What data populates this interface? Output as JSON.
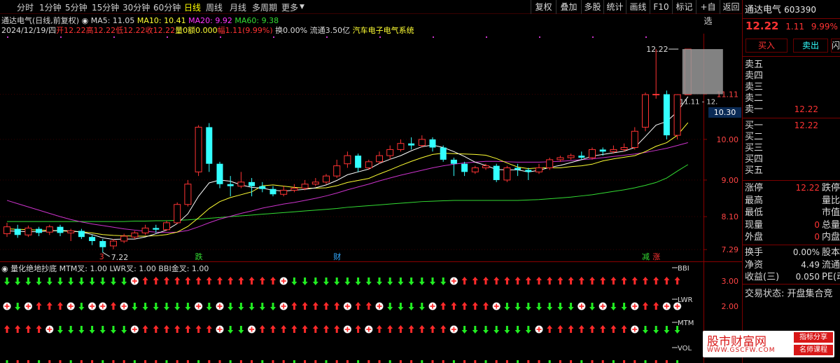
{
  "toolbar": {
    "left_items": [
      "分时",
      "1分钟",
      "5分钟",
      "15分钟",
      "30分钟",
      "60分钟",
      "日线",
      "周线",
      "月线",
      "多周期",
      "更多"
    ],
    "active_index": 6,
    "right_items": [
      "复权",
      "叠加",
      "多股",
      "统计",
      "画线",
      "F10",
      "标记",
      "+自选",
      "返回"
    ]
  },
  "info": {
    "name_mode": "通达电气(日线,前复权)",
    "ma5": "MA5: 11.05",
    "ma10": "MA10: 10.41",
    "ma20": "MA20: 9.92",
    "ma60": "MA60: 9.38",
    "date": "2024/12/19/四",
    "open": "开12.22",
    "high": "高12.22",
    "low": "低12.22",
    "close": "收12.22",
    "vol": "量0",
    "amount": "额0.000",
    "change": "幅1.11(9.99%)",
    "turnover": "换0.00%",
    "float": "流通3.50亿",
    "sector": "汽车电子电气系统",
    "colors": {
      "ma5": "#ffffff",
      "ma10": "#ffff33",
      "ma20": "#ff33ff",
      "ma60": "#33dd33",
      "up": "#ff3333",
      "down": "#33ffff"
    }
  },
  "main_chart": {
    "y_labels": [
      "11.11",
      "10.00",
      "9.00",
      "8.10",
      "7.29"
    ],
    "y_values": [
      11.11,
      10.0,
      9.0,
      8.1,
      7.29
    ],
    "high_marker": "12.22",
    "low_marker": "7.22",
    "range_label": "11.11 - 12.",
    "current_price_tag": "10.30",
    "event_marks": [
      {
        "index": 9,
        "text": "3",
        "color": "#ff3333"
      },
      {
        "index": 18,
        "text": "跌",
        "color": "#33dd33"
      },
      {
        "index": 31,
        "text": "财",
        "color": "#33aaff"
      },
      {
        "index": 60,
        "text": "减",
        "color": "#33dd33"
      },
      {
        "index": 61,
        "text": "涨",
        "color": "#ff3333"
      }
    ]
  },
  "chart_data": {
    "type": "candlestick",
    "ylim": [
      7.0,
      12.6
    ],
    "candles": [
      [
        7.68,
        7.85,
        7.6,
        7.95
      ],
      [
        7.8,
        7.65,
        7.58,
        7.9
      ],
      [
        7.65,
        7.82,
        7.6,
        7.88
      ],
      [
        7.8,
        7.7,
        7.62,
        7.85
      ],
      [
        7.72,
        7.85,
        7.65,
        7.9
      ],
      [
        7.85,
        7.7,
        7.62,
        7.9
      ],
      [
        7.7,
        7.75,
        7.5,
        7.8
      ],
      [
        7.75,
        7.6,
        7.55,
        7.8
      ],
      [
        7.6,
        7.5,
        7.4,
        7.65
      ],
      [
        7.5,
        7.35,
        7.22,
        7.55
      ],
      [
        7.38,
        7.5,
        7.3,
        7.55
      ],
      [
        7.5,
        7.62,
        7.45,
        7.68
      ],
      [
        7.6,
        7.7,
        7.55,
        7.75
      ],
      [
        7.7,
        7.82,
        7.65,
        7.9
      ],
      [
        7.82,
        7.78,
        7.7,
        7.9
      ],
      [
        7.78,
        7.95,
        7.75,
        8.0
      ],
      [
        7.95,
        8.4,
        7.92,
        8.45
      ],
      [
        8.4,
        8.9,
        8.35,
        9.0
      ],
      [
        9.2,
        10.3,
        9.1,
        10.35
      ],
      [
        10.3,
        9.4,
        9.2,
        10.4
      ],
      [
        9.4,
        8.9,
        8.8,
        9.45
      ],
      [
        8.9,
        8.85,
        8.6,
        9.1
      ],
      [
        8.85,
        8.95,
        8.8,
        9.2
      ],
      [
        8.95,
        8.85,
        8.6,
        9.05
      ],
      [
        8.85,
        8.78,
        8.7,
        8.95
      ],
      [
        8.78,
        8.65,
        8.6,
        8.85
      ],
      [
        8.65,
        8.75,
        8.6,
        8.85
      ],
      [
        8.75,
        8.8,
        8.7,
        8.9
      ],
      [
        8.8,
        8.9,
        8.75,
        9.0
      ],
      [
        8.9,
        8.95,
        8.85,
        9.05
      ],
      [
        8.95,
        9.1,
        8.9,
        9.15
      ],
      [
        9.1,
        9.35,
        9.05,
        9.5
      ],
      [
        9.4,
        9.6,
        9.3,
        9.7
      ],
      [
        9.6,
        9.3,
        9.2,
        9.65
      ],
      [
        9.3,
        9.45,
        9.25,
        9.5
      ],
      [
        9.45,
        9.6,
        9.4,
        9.7
      ],
      [
        9.6,
        9.75,
        9.5,
        9.85
      ],
      [
        9.75,
        9.9,
        9.7,
        10.0
      ],
      [
        9.9,
        9.85,
        9.75,
        10.05
      ],
      [
        9.85,
        10.0,
        9.8,
        10.1
      ],
      [
        10.0,
        9.8,
        9.7,
        10.05
      ],
      [
        9.8,
        9.5,
        9.45,
        9.85
      ],
      [
        9.5,
        9.4,
        9.1,
        9.55
      ],
      [
        9.4,
        9.2,
        9.1,
        9.45
      ],
      [
        9.2,
        9.3,
        9.15,
        9.35
      ],
      [
        9.3,
        9.35,
        9.25,
        9.4
      ],
      [
        9.35,
        9.0,
        8.95,
        9.4
      ],
      [
        9.0,
        9.3,
        8.95,
        9.35
      ],
      [
        9.3,
        9.25,
        9.1,
        9.4
      ],
      [
        9.25,
        9.2,
        9.0,
        9.3
      ],
      [
        9.2,
        9.3,
        9.15,
        9.4
      ],
      [
        9.3,
        9.5,
        9.25,
        9.55
      ],
      [
        9.5,
        9.55,
        9.45,
        9.6
      ],
      [
        9.55,
        9.6,
        9.5,
        9.65
      ],
      [
        9.6,
        9.55,
        9.5,
        9.7
      ],
      [
        9.55,
        9.75,
        9.5,
        9.8
      ],
      [
        9.75,
        9.7,
        9.6,
        9.8
      ],
      [
        9.7,
        9.75,
        9.65,
        9.85
      ],
      [
        9.75,
        9.8,
        9.7,
        9.9
      ],
      [
        9.8,
        10.2,
        9.75,
        10.3
      ],
      [
        10.3,
        11.1,
        10.2,
        11.15
      ],
      [
        11.1,
        11.11,
        11.0,
        12.22
      ],
      [
        11.11,
        10.1,
        10.0,
        11.2
      ],
      [
        10.1,
        11.1,
        10.0,
        11.11
      ],
      [
        11.1,
        12.22,
        11.1,
        12.22
      ]
    ],
    "ma5": [
      7.75,
      7.74,
      7.73,
      7.73,
      7.75,
      7.76,
      7.75,
      7.72,
      7.66,
      7.58,
      7.54,
      7.55,
      7.55,
      7.6,
      7.68,
      7.77,
      7.93,
      8.17,
      8.6,
      8.93,
      9.0,
      8.97,
      8.88,
      8.82,
      8.8,
      8.75,
      8.73,
      8.75,
      8.77,
      8.81,
      8.88,
      8.99,
      9.13,
      9.2,
      9.27,
      9.41,
      9.51,
      9.6,
      9.72,
      9.82,
      9.86,
      9.8,
      9.7,
      9.58,
      9.44,
      9.36,
      9.26,
      9.25,
      9.25,
      9.2,
      9.24,
      9.31,
      9.36,
      9.43,
      9.5,
      9.59,
      9.63,
      9.67,
      9.71,
      9.8,
      10.07,
      10.35,
      10.44,
      10.68,
      11.05
    ],
    "ma10": [
      7.8,
      7.79,
      7.78,
      7.77,
      7.76,
      7.75,
      7.74,
      7.73,
      7.7,
      7.66,
      7.64,
      7.63,
      7.62,
      7.62,
      7.63,
      7.66,
      7.72,
      7.86,
      8.07,
      8.3,
      8.47,
      8.57,
      8.64,
      8.71,
      8.86,
      8.88,
      8.85,
      8.82,
      8.8,
      8.8,
      8.81,
      8.86,
      8.94,
      8.99,
      9.04,
      9.15,
      9.25,
      9.36,
      9.46,
      9.55,
      9.63,
      9.66,
      9.65,
      9.64,
      9.63,
      9.61,
      9.53,
      9.42,
      9.32,
      9.28,
      9.3,
      9.3,
      9.3,
      9.33,
      9.35,
      9.39,
      9.47,
      9.52,
      9.56,
      9.6,
      9.7,
      9.83,
      9.92,
      10.1,
      10.41
    ],
    "ma20": [
      8.5,
      8.42,
      8.34,
      8.26,
      8.18,
      8.1,
      8.03,
      7.97,
      7.92,
      7.88,
      7.84,
      7.8,
      7.77,
      7.74,
      7.72,
      7.71,
      7.72,
      7.76,
      7.85,
      7.95,
      8.04,
      8.11,
      8.18,
      8.24,
      8.31,
      8.36,
      8.41,
      8.45,
      8.5,
      8.55,
      8.61,
      8.68,
      8.76,
      8.83,
      8.9,
      8.98,
      9.05,
      9.12,
      9.18,
      9.24,
      9.3,
      9.35,
      9.39,
      9.42,
      9.44,
      9.46,
      9.46,
      9.45,
      9.44,
      9.44,
      9.44,
      9.45,
      9.46,
      9.48,
      9.5,
      9.52,
      9.55,
      9.58,
      9.61,
      9.64,
      9.68,
      9.73,
      9.78,
      9.85,
      9.92
    ],
    "ma60": [
      7.98,
      7.98,
      7.98,
      7.98,
      7.98,
      7.98,
      7.98,
      7.98,
      7.98,
      7.98,
      7.98,
      7.98,
      7.99,
      7.99,
      8.0,
      8.0,
      8.01,
      8.02,
      8.04,
      8.06,
      8.08,
      8.1,
      8.12,
      8.14,
      8.16,
      8.18,
      8.2,
      8.22,
      8.24,
      8.26,
      8.28,
      8.3,
      8.33,
      8.35,
      8.37,
      8.39,
      8.41,
      8.43,
      8.45,
      8.47,
      8.48,
      8.49,
      8.5,
      8.5,
      8.5,
      8.5,
      8.5,
      8.5,
      8.5,
      8.51,
      8.52,
      8.54,
      8.56,
      8.58,
      8.61,
      8.64,
      8.68,
      8.72,
      8.76,
      8.81,
      8.87,
      8.94,
      9.05,
      9.22,
      9.38
    ]
  },
  "indicator": {
    "title": "量化绝地抄底",
    "mtm": "MTM叉: 1.00",
    "lwr": "LWR叉: 1.00",
    "bbi": "BBI金叉: 1.00",
    "row_labels": [
      "BBI",
      "LWR",
      "MTM",
      "VOL"
    ],
    "y_labels": [
      "3.00",
      "2.00"
    ],
    "rows": [
      "ddddddddddddddddddddddddddddddddddddddddddddddddddddddddddddddddd",
      "ccccccccccccccccccccccccccccccccccccccccccccccccccccccccccccccccc",
      "uuuuuuuuuuuuuuuuuuuuuuuuuuuuuuuuuuuuuuuuuuuuuuuuuuuuuuuuuuuuuuuuu"
    ],
    "row_data": [
      "ddddddddddddcuuuuuuuuuuuuucdddddddddddddddcuuuuuuuuuuuuuuuuuuuuuu",
      "cdcuuucdccucddddddcdcdddddcuuuuucuucddddcuuuuucdddddddcdcddcuucc",
      "uuuucdddddddcuuuuuuucddcuuuuuuuucucuuuuuuucdddddddcuuuuuuuucdddd"
    ],
    "row_values": [
      3.0,
      2.0,
      1.0
    ]
  },
  "right_panel": {
    "stock_name": "通达电气",
    "stock_code": "603390",
    "price": "12.22",
    "change": "1.11",
    "change_pct": "9.99%",
    "buy_btn": "买入",
    "sell_btn": "卖出",
    "more_btn": "闪",
    "asks": [
      {
        "label": "卖五",
        "value": ""
      },
      {
        "label": "卖四",
        "value": ""
      },
      {
        "label": "卖三",
        "value": ""
      },
      {
        "label": "卖二",
        "value": ""
      },
      {
        "label": "卖一",
        "value": "12.22"
      }
    ],
    "bids": [
      {
        "label": "买一",
        "value": "12.22"
      },
      {
        "label": "买二",
        "value": ""
      },
      {
        "label": "买三",
        "value": ""
      },
      {
        "label": "买四",
        "value": ""
      },
      {
        "label": "买五",
        "value": ""
      }
    ],
    "stats1": [
      {
        "label": "涨停",
        "value": "12.22",
        "label2": "跌停"
      },
      {
        "label": "最高",
        "value": "",
        "label2": "量比"
      },
      {
        "label": "最低",
        "value": "",
        "label2": "市值"
      },
      {
        "label": "现量",
        "value": "0",
        "label2": "总量"
      },
      {
        "label": "外盘",
        "value": "0",
        "label2": "内盘"
      }
    ],
    "stats2": [
      {
        "label": "换手",
        "value": "0.00%",
        "label2": "股本"
      },
      {
        "label": "净资",
        "value": "4.49",
        "label2": "流通"
      },
      {
        "label": "收益(三)",
        "value": "0.050",
        "label2": "PE(动"
      }
    ],
    "trade_status": "交易状态: 开盘集合竞"
  },
  "watermark": {
    "main": "股市财富网",
    "url": "WWW.GSCFW.COM",
    "tag1": "指标分享",
    "tag2": "名师课程"
  }
}
